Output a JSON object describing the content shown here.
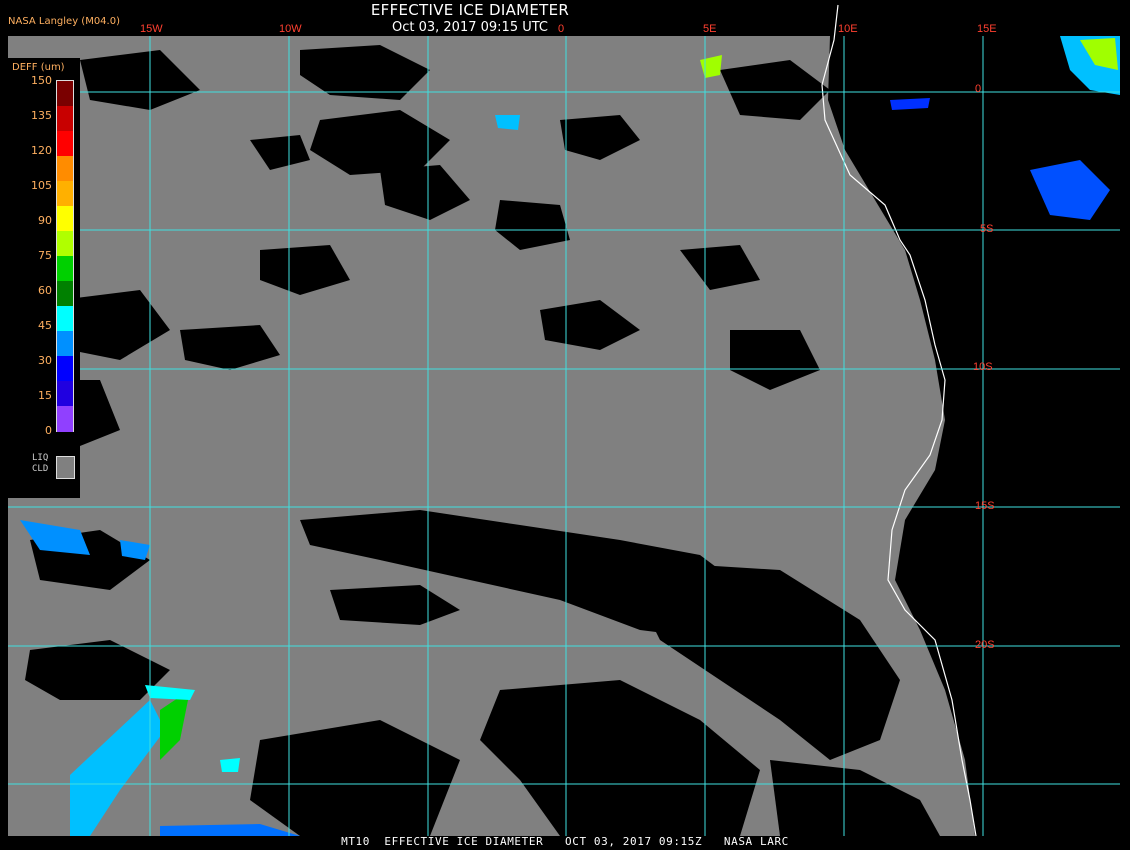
{
  "header": {
    "title": "EFFECTIVE ICE DIAMETER",
    "datetime": "Oct 03, 2017 09:15 UTC",
    "producer": "NASA Langley (M04.0)"
  },
  "footer": {
    "text": "MT10  EFFECTIVE ICE DIAMETER   OCT 03, 2017 09:15Z   NASA LARC"
  },
  "legend": {
    "title": "DEFF (um)",
    "ticks": [
      "150",
      "135",
      "120",
      "105",
      "90",
      "75",
      "60",
      "45",
      "30",
      "15",
      "0"
    ],
    "colors": [
      "#7a0000",
      "#c80000",
      "#ff0000",
      "#ff8c00",
      "#ffb000",
      "#ffff00",
      "#b0ff00",
      "#00d000",
      "#008000",
      "#00ffff",
      "#0090ff",
      "#0000ff",
      "#2000e0",
      "#9040ff"
    ],
    "liquid_label_line1": "LIQ",
    "liquid_label_line2": "CLD",
    "liquid_color": "#808080"
  },
  "map": {
    "cloud_color": "#808080",
    "clear_color": "#000000",
    "grid_color": "#40e0e0",
    "coast_color": "#ffffff",
    "lon_labels": [
      "15W",
      "10W",
      "0",
      "5E",
      "10E",
      "15E"
    ],
    "lat_labels": [
      "0",
      "5S",
      "10S",
      "15S",
      "20S"
    ]
  }
}
